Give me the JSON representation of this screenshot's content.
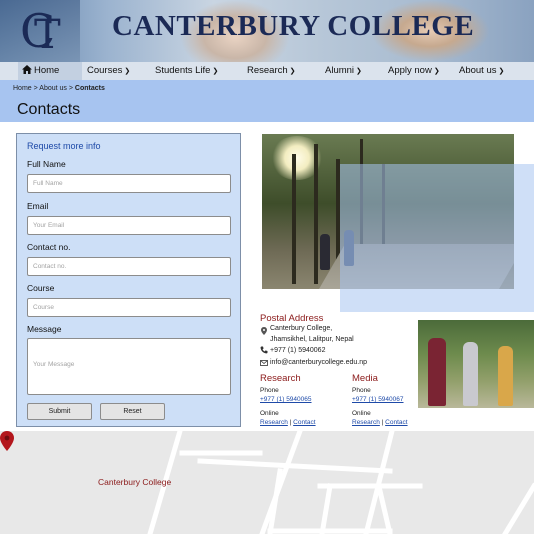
{
  "header": {
    "title": "CANTERBURY COLLEGE",
    "logo_letters": "CT"
  },
  "nav": {
    "items": [
      {
        "label": "Home",
        "icon": "home-icon"
      },
      {
        "label": "Courses",
        "has_dropdown": true
      },
      {
        "label": "Students Life",
        "has_dropdown": true
      },
      {
        "label": "Research",
        "has_dropdown": true
      },
      {
        "label": "Alumni",
        "has_dropdown": true
      },
      {
        "label": "Apply now",
        "has_dropdown": true
      },
      {
        "label": "About us",
        "has_dropdown": true
      }
    ]
  },
  "breadcrumb": {
    "home": "Home",
    "sep1": " > ",
    "about": "About us",
    "sep2": " > ",
    "current": "Contacts"
  },
  "page_title": "Contacts",
  "form": {
    "heading": "Request more info",
    "fields": [
      {
        "label": "Full Name",
        "placeholder": "Full Name"
      },
      {
        "label": "Email",
        "placeholder": "Your Email"
      },
      {
        "label": "Contact no.",
        "placeholder": "Contact no."
      },
      {
        "label": "Course",
        "placeholder": "Course"
      },
      {
        "label": "Message",
        "placeholder": "Your Message"
      }
    ],
    "submit_label": "Submit",
    "reset_label": "Reset"
  },
  "postal": {
    "title": "Postal Address",
    "address_line1": "Canterbury College,",
    "address_line2": "Jhamsikhel, Lalitpur, Nepal",
    "phone": "+977 (1) 5940062",
    "email": "info@canterburycollege.edu.np"
  },
  "research": {
    "title": "Research",
    "phone_label": "Phone",
    "phone": "+977 (1) 5940065",
    "online_label": "Online",
    "link1": "Research",
    "separator": "|",
    "link2": "Contact"
  },
  "media": {
    "title": "Media",
    "phone_label": "Phone",
    "phone": "+977 (1) 5940067",
    "online_label": "Online",
    "link1": "Research",
    "separator": "|",
    "link2": "Contact"
  },
  "map": {
    "label": "Canterbury College"
  },
  "colors": {
    "brand_navy": "#1b2a56",
    "title_bar": "#a7c4f0",
    "form_bg": "#cddff7",
    "accent_red": "#8b1a1a",
    "link_blue": "#1e4aa8"
  }
}
